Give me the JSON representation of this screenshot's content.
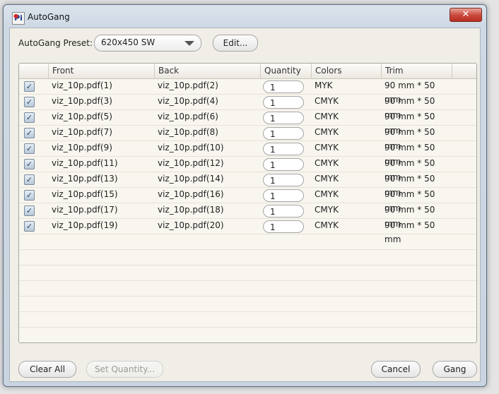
{
  "window": {
    "title": "AutoGang",
    "close_glyph": "✕"
  },
  "preset": {
    "label": "AutoGang Preset:",
    "value": "620x450 SW",
    "edit_label": "Edit..."
  },
  "table": {
    "columns": [
      "",
      "Front",
      "Back",
      "Quantity",
      "Colors",
      "Trim"
    ],
    "rows": [
      {
        "front": "viz_10p.pdf(1)",
        "back": "viz_10p.pdf(2)",
        "qty": "1",
        "colors": "MYK",
        "trim": "90 mm * 50 mm"
      },
      {
        "front": "viz_10p.pdf(3)",
        "back": "viz_10p.pdf(4)",
        "qty": "1",
        "colors": "CMYK",
        "trim": "90 mm * 50 mm"
      },
      {
        "front": "viz_10p.pdf(5)",
        "back": "viz_10p.pdf(6)",
        "qty": "1",
        "colors": "CMYK",
        "trim": "90 mm * 50 mm"
      },
      {
        "front": "viz_10p.pdf(7)",
        "back": "viz_10p.pdf(8)",
        "qty": "1",
        "colors": "CMYK",
        "trim": "90 mm * 50 mm"
      },
      {
        "front": "viz_10p.pdf(9)",
        "back": "viz_10p.pdf(10)",
        "qty": "1",
        "colors": "CMYK",
        "trim": "90 mm * 50 mm"
      },
      {
        "front": "viz_10p.pdf(11)",
        "back": "viz_10p.pdf(12)",
        "qty": "1",
        "colors": "CMYK",
        "trim": "90 mm * 50 mm"
      },
      {
        "front": "viz_10p.pdf(13)",
        "back": "viz_10p.pdf(14)",
        "qty": "1",
        "colors": "CMYK",
        "trim": "90 mm * 50 mm"
      },
      {
        "front": "viz_10p.pdf(15)",
        "back": "viz_10p.pdf(16)",
        "qty": "1",
        "colors": "CMYK",
        "trim": "90 mm * 50 mm"
      },
      {
        "front": "viz_10p.pdf(17)",
        "back": "viz_10p.pdf(18)",
        "qty": "1",
        "colors": "CMYK",
        "trim": "90 mm * 50 mm"
      },
      {
        "front": "viz_10p.pdf(19)",
        "back": "viz_10p.pdf(20)",
        "qty": "1",
        "colors": "CMYK",
        "trim": "90 mm * 50 mm"
      }
    ]
  },
  "footer": {
    "clear_all": "Clear All",
    "set_quantity": "Set Quantity...",
    "cancel": "Cancel",
    "gang": "Gang"
  }
}
